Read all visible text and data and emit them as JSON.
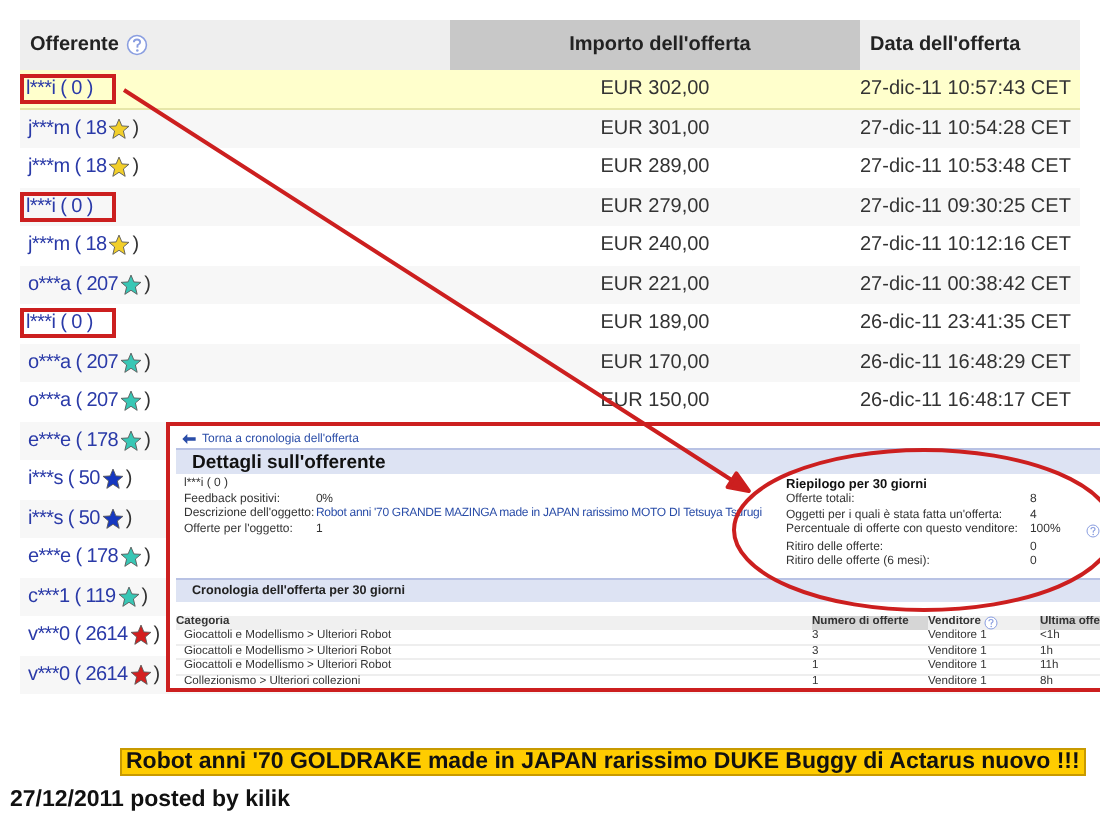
{
  "bids_table": {
    "columns": [
      {
        "label": "Offerente",
        "help": true,
        "shaded": false
      },
      {
        "label": "Importo dell'offerta",
        "help": false,
        "shaded": true
      },
      {
        "label": "Data dell'offerta",
        "help": false,
        "shaded": false
      }
    ],
    "rows": [
      {
        "bidder": "l***i ( 0 )",
        "amount": "EUR 302,00",
        "date": "27-dic-11 10:57:43 CET",
        "highlighted": true,
        "boxed": true
      },
      {
        "bidder": "j***m ( 18",
        "color": "#f2cf2a",
        "suffix": ")",
        "amount": "EUR 301,00",
        "date": "27-dic-11 10:54:28 CET",
        "highlighted": false,
        "boxed": false
      },
      {
        "bidder": "j***m ( 18",
        "color": "#f2cf2a",
        "suffix": ")",
        "amount": "EUR 289,00",
        "date": "27-dic-11 10:53:48 CET",
        "highlighted": false,
        "boxed": false
      },
      {
        "bidder": "l***i ( 0 )",
        "amount": "EUR 279,00",
        "date": "27-dic-11 09:30:25 CET",
        "highlighted": false,
        "boxed": true
      },
      {
        "bidder": "j***m ( 18",
        "color": "#f2cf2a",
        "suffix": ")",
        "amount": "EUR 240,00",
        "date": "27-dic-11 10:12:16 CET",
        "highlighted": false,
        "boxed": false
      },
      {
        "bidder": "o***a ( 207",
        "color": "#38c7b5",
        "suffix": ")",
        "amount": "EUR 221,00",
        "date": "27-dic-11 00:38:42 CET",
        "highlighted": false,
        "boxed": false
      },
      {
        "bidder": "l***i ( 0 )",
        "amount": "EUR 189,00",
        "date": "26-dic-11 23:41:35 CET",
        "highlighted": false,
        "boxed": true
      },
      {
        "bidder": "o***a ( 207",
        "color": "#38c7b5",
        "suffix": ")",
        "amount": "EUR 170,00",
        "date": "26-dic-11 16:48:29 CET",
        "highlighted": false,
        "boxed": false
      },
      {
        "bidder": "o***a ( 207",
        "color": "#38c7b5",
        "suffix": ")",
        "amount": "EUR 150,00",
        "date": "26-dic-11 16:48:17 CET",
        "highlighted": false,
        "boxed": false
      },
      {
        "bidder": "e***e ( 178",
        "color": "#38c7b5",
        "suffix": ")",
        "highlighted": false,
        "boxed": false
      },
      {
        "bidder": "i***s ( 50",
        "color": "#1638c0",
        "suffix": ")",
        "highlighted": false,
        "boxed": false
      },
      {
        "bidder": "i***s ( 50",
        "color": "#1638c0",
        "suffix": ")",
        "highlighted": false,
        "boxed": false
      },
      {
        "bidder": "e***e ( 178",
        "color": "#38c7b5",
        "suffix": ")",
        "highlighted": false,
        "boxed": false
      },
      {
        "bidder": "c***1 ( 119",
        "color": "#38c7b5",
        "suffix": ")",
        "highlighted": false,
        "boxed": false
      },
      {
        "bidder": "v***0 ( 2614",
        "color": "#d41f1f",
        "suffix": ")",
        "highlighted": false,
        "boxed": false
      },
      {
        "bidder": "v***0 ( 2614",
        "color": "#d41f1f",
        "suffix": ")",
        "highlighted": false,
        "boxed": false
      }
    ]
  },
  "bidder_popup": {
    "back_link": "Torna a cronologia dell'offerta",
    "title": "Dettagli sull'offerente",
    "user": "l***i ( 0 )",
    "details": [
      {
        "label": "Feedback positivi:",
        "value": "0%",
        "link": false
      },
      {
        "label": "Descrizione dell'oggetto:",
        "value": "Robot anni '70 GRANDE MAZINGA made in JAPAN rarissimo MOTO DI Tetsuya Tsurugi",
        "link": true
      },
      {
        "label": "Offerte per l'oggetto:",
        "value": "1",
        "link": false
      }
    ],
    "summary": {
      "title": "Riepilogo per 30 giorni",
      "rows": [
        {
          "label": "Offerte totali:",
          "value": "8",
          "help": false
        },
        {
          "label": "Oggetti per i quali è stata fatta un'offerta:",
          "value": "4",
          "help": false
        },
        {
          "label": "Percentuale di offerte con questo venditore:",
          "value": "100%",
          "help": true
        },
        {
          "label": "Ritiro delle offerte:",
          "value": "0",
          "help": false
        },
        {
          "label": "Ritiro delle offerte (6 mesi):",
          "value": "0",
          "help": false
        }
      ]
    },
    "history_title": "Cronologia dell'offerta per 30 giorni",
    "history_columns": [
      {
        "label": "Categoria",
        "shaded": false,
        "help": false
      },
      {
        "label": "Numero di offerte",
        "shaded": true,
        "help": false
      },
      {
        "label": "Venditore",
        "shaded": false,
        "help": true
      },
      {
        "label": "Ultima offe",
        "shaded": true,
        "help": false
      }
    ],
    "history_rows": [
      [
        "Giocattoli e Modellismo > Ulteriori Robot",
        "3",
        "Venditore 1",
        "<1h"
      ],
      [
        "Giocattoli e Modellismo > Ulteriori Robot",
        "3",
        "Venditore 1",
        "1h"
      ],
      [
        "Giocattoli e Modellismo > Ulteriori Robot",
        "1",
        "Venditore 1",
        "11h"
      ],
      [
        "Collezionismo > Ulteriori collezioni",
        "1",
        "Venditore 1",
        "8h"
      ]
    ]
  },
  "post_title": "Robot anni '70 GOLDRAKE made in JAPAN rarissimo DUKE Buggy di Actarus nuovo !!!",
  "post_meta": "27/12/2011 posted by kilik"
}
